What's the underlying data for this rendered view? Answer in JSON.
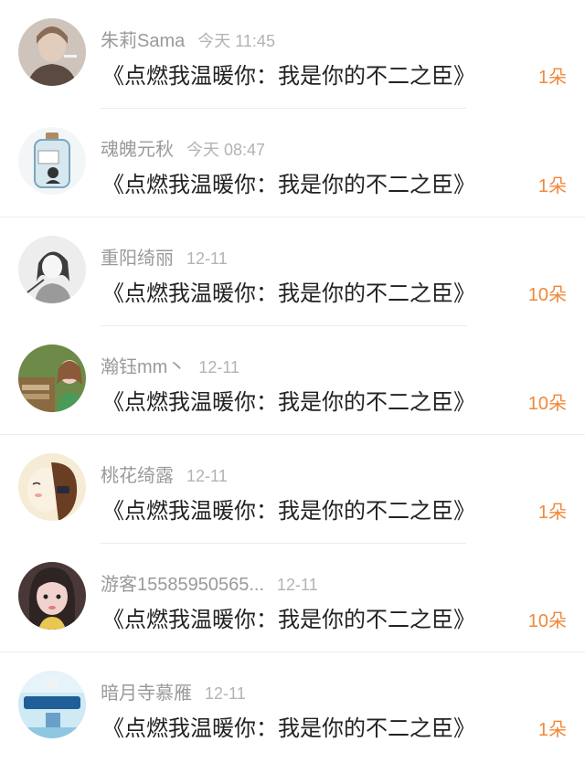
{
  "items": [
    {
      "name": "朱莉Sama",
      "time": "今天 11:45",
      "title": "《点燃我温暖你：我是你的不二之臣》",
      "count": "1朵",
      "avatar_icon": "person-avatar",
      "colors": [
        "#9c8e85",
        "#d9cfc6"
      ]
    },
    {
      "name": "魂魄元秋",
      "time": "今天 08:47",
      "title": "《点燃我温暖你：我是你的不二之臣》",
      "count": "1朵",
      "avatar_icon": "jar-avatar",
      "colors": [
        "#dfe9ee",
        "#7aa6bd"
      ]
    },
    {
      "name": "重阳绮丽",
      "time": "12-11",
      "title": "《点燃我温暖你：我是你的不二之臣》",
      "count": "10朵",
      "avatar_icon": "sketch-avatar",
      "colors": [
        "#e6e6e6",
        "#6b6b6b"
      ]
    },
    {
      "name": "瀚钰mm丶",
      "time": "12-11",
      "title": "《点燃我温暖你：我是你的不二之臣》",
      "count": "10朵",
      "avatar_icon": "photo-avatar",
      "colors": [
        "#5c7a3a",
        "#d8a8a0"
      ]
    },
    {
      "name": "桃花绮露",
      "time": "12-11",
      "title": "《点燃我温暖你：我是你的不二之臣》",
      "count": "1朵",
      "avatar_icon": "drawing-avatar",
      "colors": [
        "#f5ead2",
        "#7a4a2a"
      ]
    },
    {
      "name": "游客15585950565...",
      "time": "12-11",
      "title": "《点燃我温暖你：我是你的不二之臣》",
      "count": "10朵",
      "avatar_icon": "girl-avatar",
      "colors": [
        "#3a3030",
        "#e8b9b8"
      ]
    },
    {
      "name": "暗月寺慕雁",
      "time": "12-11",
      "title": "《点燃我温暖你：我是你的不二之臣》",
      "count": "1朵",
      "avatar_icon": "poster-avatar",
      "colors": [
        "#bfe3f2",
        "#2b6ea6"
      ]
    }
  ]
}
